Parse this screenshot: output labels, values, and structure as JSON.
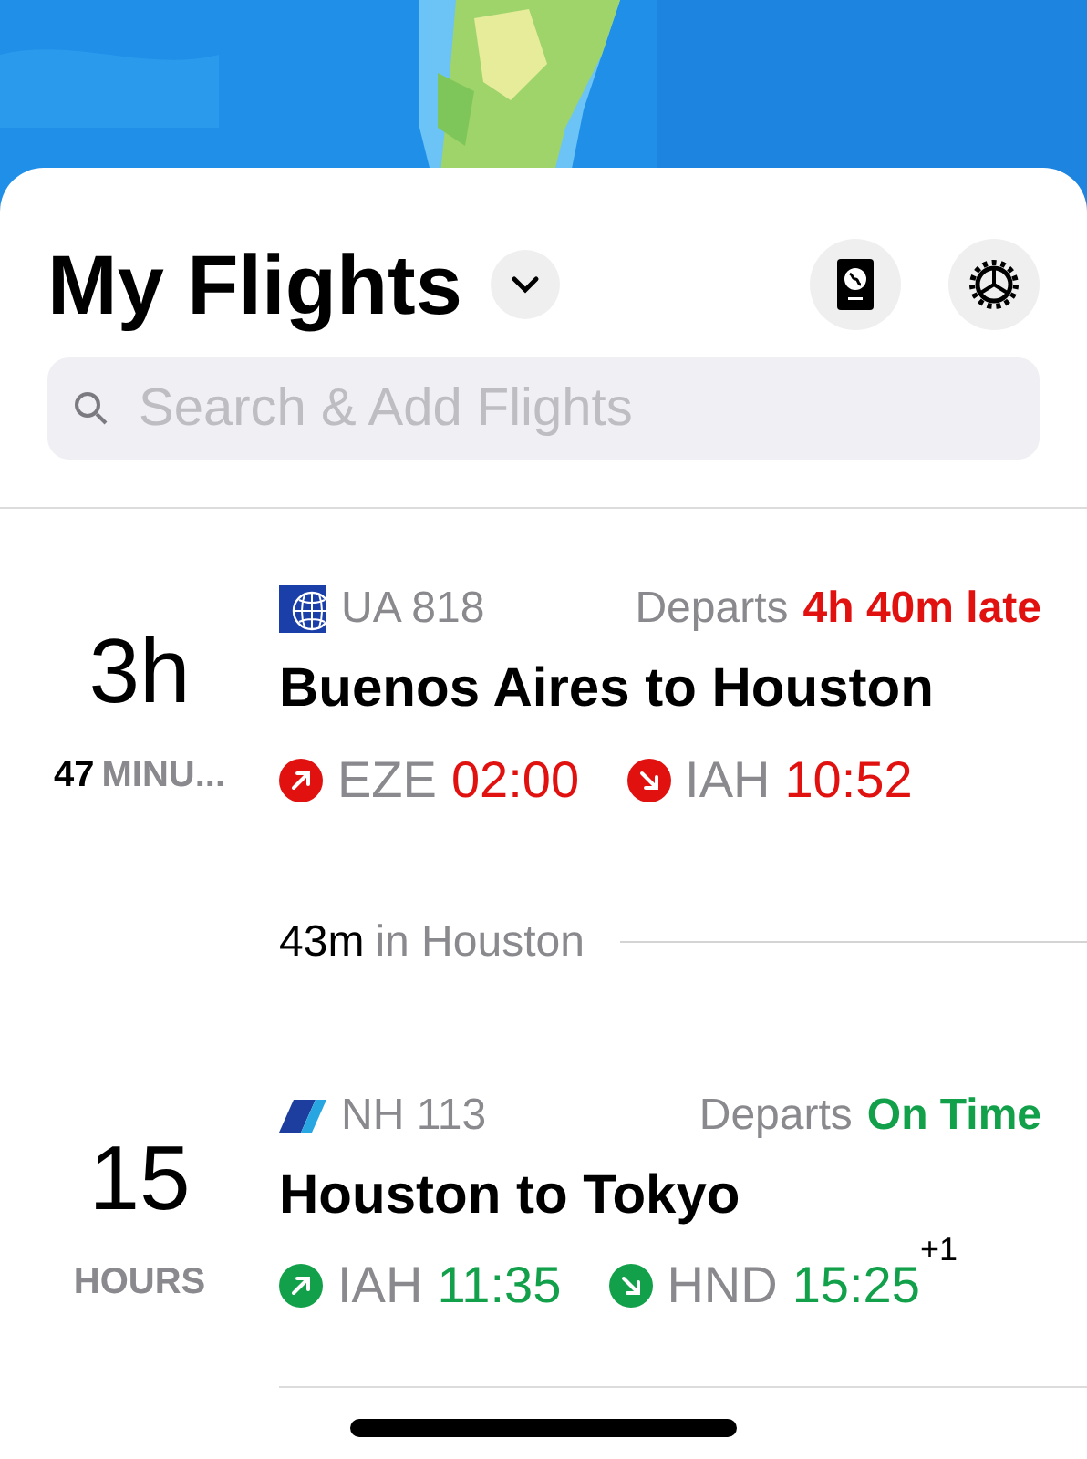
{
  "header": {
    "title": "My Flights"
  },
  "search": {
    "placeholder": "Search & Add Flights"
  },
  "flights": [
    {
      "duration": {
        "main": "3h",
        "sub_value": "47",
        "sub_unit": "MINU..."
      },
      "kind": "globe",
      "flight_number": "UA 818",
      "departs_label": "Departs",
      "color": "#e0110f",
      "status_text": "4h 40m late",
      "route": "Buenos Aires to Houston",
      "departure": {
        "code": "EZE",
        "time": "02:00"
      },
      "arrival": {
        "code": "IAH",
        "time": "10:52"
      },
      "layover": {
        "duration": "43m",
        "place": "in Houston"
      }
    },
    {
      "duration": {
        "main": "15",
        "sub_unit": "HOURS"
      },
      "kind": "stripe",
      "flight_number": "NH 113",
      "departs_label": "Departs",
      "color": "#12a14a",
      "status_text": "On Time",
      "route": "Houston to Tokyo",
      "departure": {
        "code": "IAH",
        "time": "11:35"
      },
      "arrival": {
        "code": "HND",
        "time": "15:25",
        "day_offset": "+1"
      }
    }
  ]
}
